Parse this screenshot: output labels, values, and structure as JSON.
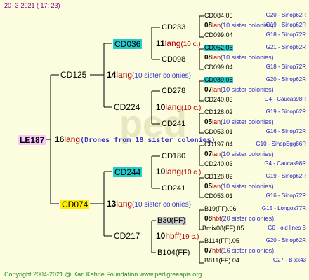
{
  "header": "20-  3-2021 ( 17: 23)",
  "footer": "Copyright 2004-2021 @ Karl Kehrle Foundation     www.pedigreeapis.org",
  "root": {
    "label": "LE187",
    "num": "16",
    "lang": "lang",
    "note": "(Drones from 18 sister colonies)"
  },
  "gen1": [
    {
      "label": "CD125",
      "num": "14",
      "lang": "lang",
      "note": "(10 sister colonies)"
    },
    {
      "label": "CD074",
      "num": "13",
      "lang": "lang",
      "note": "(10 sister colonies)"
    }
  ],
  "gen2": [
    {
      "label": "CD036",
      "num": "11",
      "lang": "lang",
      "note": "(10 c.)"
    },
    {
      "label": "CD224",
      "num": "10",
      "lang": "lang",
      "note": "(10 c.)"
    },
    {
      "label": "CD244",
      "num": "10",
      "lang": "lang",
      "note": "(10 c.)"
    },
    {
      "label": "CD217",
      "num": "10",
      "lang": "hbff",
      "note": "(19 c.)"
    }
  ],
  "gen3": [
    "CD233",
    "CD098",
    "CD278",
    "CD241",
    "CD180",
    "CD241",
    "B30(FF)",
    "B104(FF)"
  ],
  "gen4": [
    {
      "queen": "CD084.05",
      "num": "08",
      "lang": "lan",
      "note": "(10 sister colonies)",
      "drone": "CD099.04"
    },
    {
      "queen": "CD052.05",
      "num": "08",
      "lang": "lan",
      "note": "(10 sister colonies)",
      "drone": "CD099.04"
    },
    {
      "queen": "CD089.05",
      "num": "07",
      "lang": "lan",
      "note": "(10 sister colonies)",
      "drone": "CD240.03"
    },
    {
      "queen": "CD128.02",
      "num": "05",
      "lang": "lan",
      "note": "(10 sister colonies)",
      "drone": "CD053.01"
    },
    {
      "queen": "CD197.04",
      "num": "07",
      "lang": "lan",
      "note": "(10 sister colonies)",
      "drone": "CD240.03"
    },
    {
      "queen": "CD128.02",
      "num": "05",
      "lang": "lan",
      "note": "(10 sister colonies)",
      "drone": "CD053.01"
    },
    {
      "queen": "B19(FF).06",
      "num": "08",
      "lang": "hbt",
      "note": "(20 sister colonies)",
      "drone": "Bmix08(FF).05"
    },
    {
      "queen": "B114(FF).05",
      "num": "07",
      "lang": "hbt",
      "note": "(16 sister colonies)",
      "drone": "B811(FF).04"
    }
  ],
  "gen5": [
    "G20 - Sinop62R",
    "G19 - Sinop62R",
    "G18 - Sinop72R",
    "G21 - Sinop62R",
    "G18 - Sinop72R",
    "G20 - Sinop62R",
    "G4 - Caucas98R",
    "G19 - Sinop62R",
    "G16 - Sinop72R",
    "G10 - SinopEgg86R",
    "G4 - Caucas98R",
    "G19 - Sinop62R",
    "G16 - Sinop72R",
    "G15 - Longos77R",
    "G0 - old lines B",
    "G20 - Sinop62R",
    "G27 - B-xx43"
  ],
  "colors": {
    "bg": "#fcfcde",
    "highlight_cyan": "#22cccc",
    "highlight_yellow": "#ffee00",
    "highlight_pink": "#f8c8f8",
    "lang": "#b00000",
    "gen5": "#1a1ad0",
    "footer": "#228b22",
    "header": "#8b008b"
  }
}
